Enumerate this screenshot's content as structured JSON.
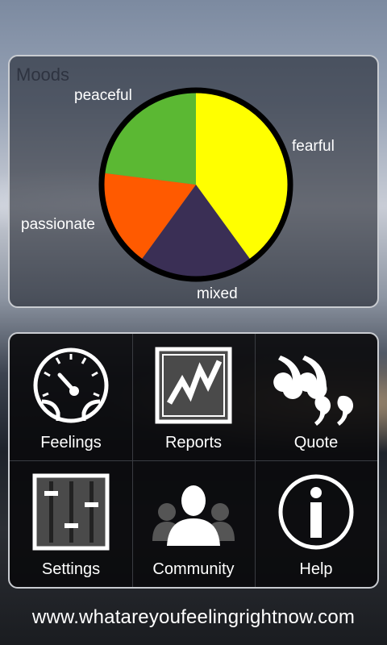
{
  "moods": {
    "title": "Moods",
    "colors": {
      "fearful": "#ffff00",
      "mixed": "#3a2f55",
      "passionate": "#ff5a00",
      "peaceful": "#5bb833"
    },
    "chart_data": {
      "type": "pie",
      "title": "Moods",
      "slices": [
        {
          "label": "fearful",
          "value": 40,
          "color": "#ffff00"
        },
        {
          "label": "mixed",
          "value": 20,
          "color": "#3a2f55"
        },
        {
          "label": "passionate",
          "value": 17,
          "color": "#ff5a00"
        },
        {
          "label": "peaceful",
          "value": 23,
          "color": "#5bb833"
        }
      ]
    }
  },
  "menu": {
    "items": [
      {
        "label": "Feelings",
        "icon": "speedometer-icon"
      },
      {
        "label": "Reports",
        "icon": "chart-icon"
      },
      {
        "label": "Quote",
        "icon": "quote-icon"
      },
      {
        "label": "Settings",
        "icon": "sliders-icon"
      },
      {
        "label": "Community",
        "icon": "people-icon"
      },
      {
        "label": "Help",
        "icon": "info-icon"
      }
    ]
  },
  "footer": {
    "url": "www.whatareyoufeelingrightnow.com"
  }
}
